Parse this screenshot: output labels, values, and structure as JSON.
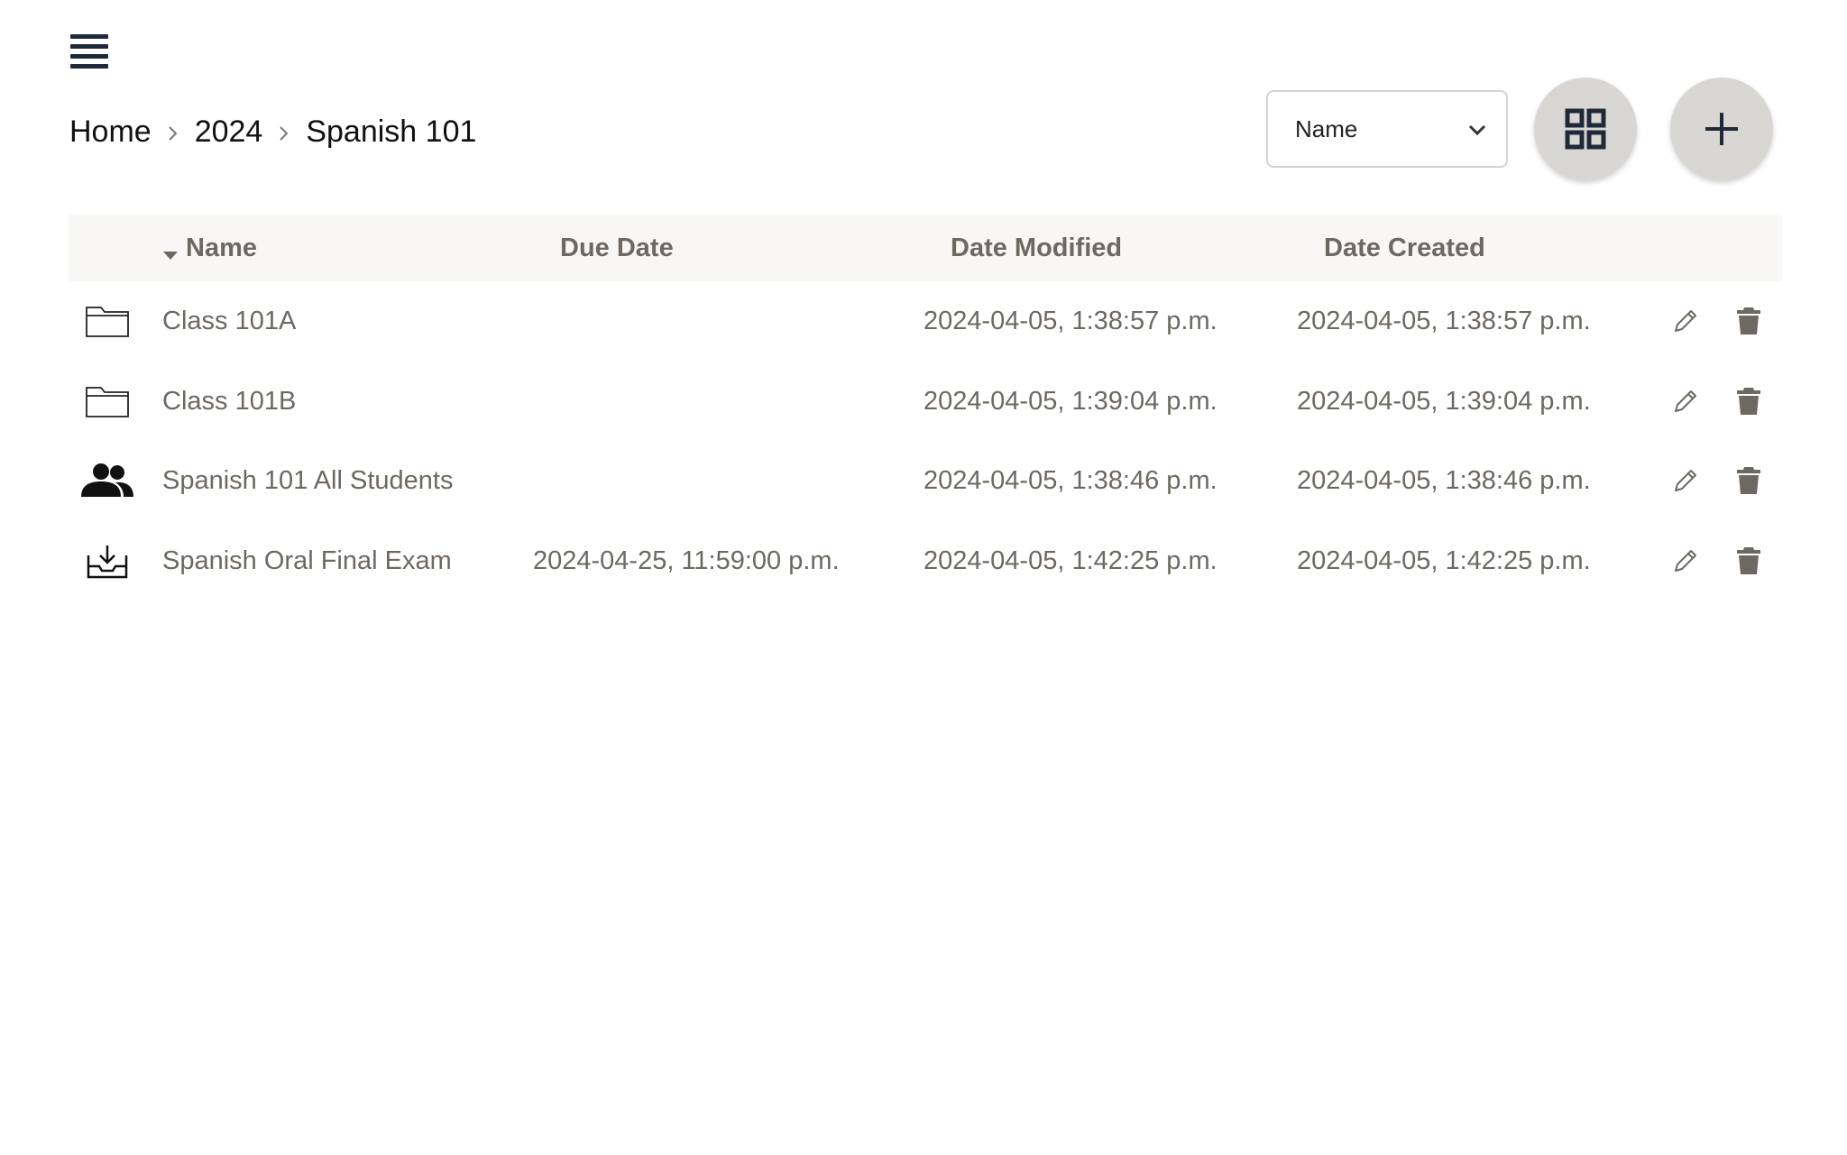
{
  "breadcrumb": {
    "items": [
      "Home",
      "2024",
      "Spanish 101"
    ]
  },
  "sort": {
    "selected": "Name"
  },
  "table": {
    "headers": {
      "name": "Name",
      "due_date": "Due Date",
      "date_modified": "Date Modified",
      "date_created": "Date Created"
    },
    "rows": [
      {
        "icon": "folder-icon",
        "name": "Class 101A",
        "due_date": "",
        "date_modified": "2024-04-05, 1:38:57 p.m.",
        "date_created": "2024-04-05, 1:38:57 p.m."
      },
      {
        "icon": "folder-icon",
        "name": "Class 101B",
        "due_date": "",
        "date_modified": "2024-04-05, 1:39:04 p.m.",
        "date_created": "2024-04-05, 1:39:04 p.m."
      },
      {
        "icon": "group-icon",
        "name": "Spanish 101 All Students",
        "due_date": "",
        "date_modified": "2024-04-05, 1:38:46 p.m.",
        "date_created": "2024-04-05, 1:38:46 p.m."
      },
      {
        "icon": "inbox-download-icon",
        "name": "Spanish Oral Final Exam",
        "due_date": "2024-04-25, 11:59:00 p.m.",
        "date_modified": "2024-04-05, 1:42:25 p.m.",
        "date_created": "2024-04-05, 1:42:25 p.m."
      }
    ]
  },
  "colors": {
    "text_primary": "#111111",
    "text_muted": "#6e6862",
    "header_bg": "#f8f7f5",
    "button_bg": "#d9d7d4",
    "icon_dark": "#1f2937"
  }
}
